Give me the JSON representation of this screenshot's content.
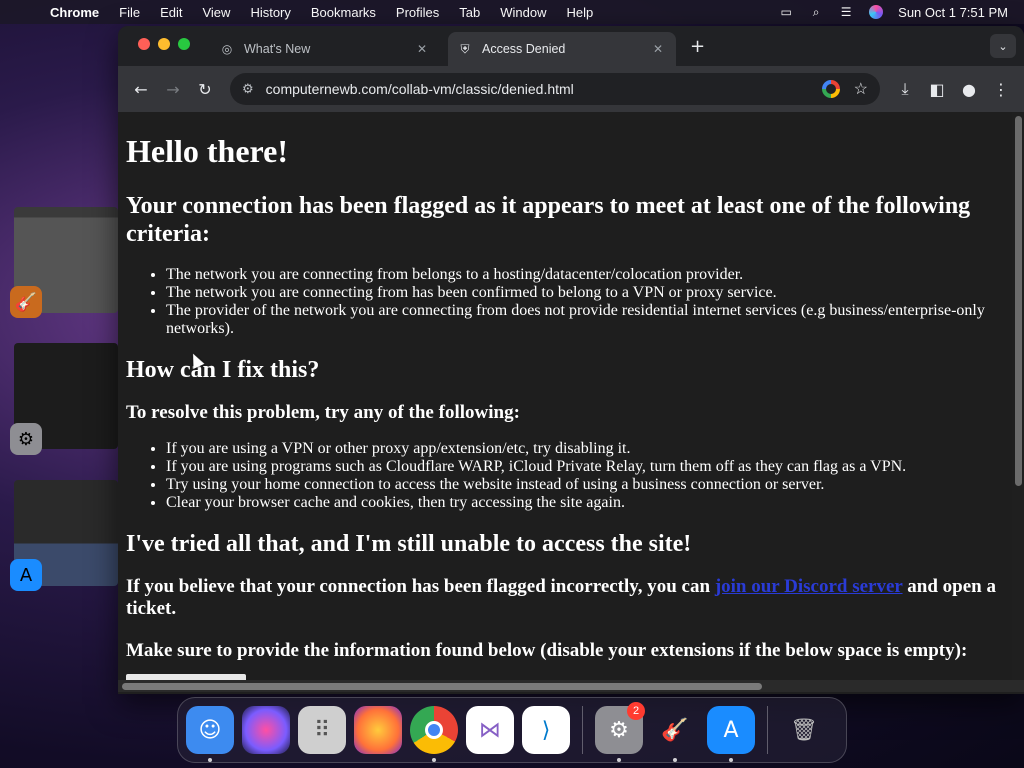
{
  "menubar": {
    "app_name": "Chrome",
    "items": [
      "File",
      "Edit",
      "View",
      "History",
      "Bookmarks",
      "Profiles",
      "Tab",
      "Window",
      "Help"
    ],
    "clock": "Sun Oct 1  7:51 PM"
  },
  "browser": {
    "tabs": [
      {
        "title": "What's New",
        "icon": "chrome-icon",
        "active": false
      },
      {
        "title": "Access Denied",
        "icon": "shield-icon",
        "active": true
      }
    ],
    "url": "computernewb.com/collab-vm/classic/denied.html"
  },
  "page": {
    "heading": "Hello there!",
    "flagged_heading": "Your connection has been flagged as it appears to meet at least one of the following criteria:",
    "criteria": [
      "The network you are connecting from belongs to a hosting/datacenter/colocation provider.",
      "The network you are connecting from has been confirmed to belong to a VPN or proxy service.",
      "The provider of the network you are connecting from does not provide residential internet services (e.g business/enterprise-only networks)."
    ],
    "fix_heading": "How can I fix this?",
    "resolve_heading": "To resolve this problem, try any of the following:",
    "fixes": [
      "If you are using a VPN or other proxy app/extension/etc, try disabling it.",
      "If you are using programs such as Cloudflare WARP, iCloud Private Relay, turn them off as they can flag as a VPN.",
      "Try using your home connection to access the website instead of using a business connection or server.",
      "Clear your browser cache and cookies, then try accessing the site again."
    ],
    "still_heading": "I've tried all that, and I'm still unable to access the site!",
    "incorrect_prefix": "If you believe that your connection has been flagged incorrectly, you can ",
    "discord_link": "join our Discord server",
    "incorrect_suffix": " and open a ticket.",
    "info_text": "Make sure to provide the information found below (disable your extensions if the below space is empty):"
  },
  "dock": {
    "items": [
      {
        "name": "finder",
        "color": "#3d8bf0"
      },
      {
        "name": "siri",
        "color": "#7a5cff"
      },
      {
        "name": "launchpad",
        "color": "#cfcfcf"
      },
      {
        "name": "firefox",
        "color": "#ff7139"
      },
      {
        "name": "chrome",
        "color": "#4285f4"
      },
      {
        "name": "visual-studio",
        "color": "#865fc5"
      },
      {
        "name": "vscode",
        "color": "#007acc"
      },
      {
        "name": "system-settings",
        "color": "#8e8e93",
        "badge": "2"
      },
      {
        "name": "garageband",
        "color": "#e07b24"
      },
      {
        "name": "app-store",
        "color": "#1a8cff"
      },
      {
        "name": "trash",
        "color": "#9a9a9a"
      }
    ]
  }
}
